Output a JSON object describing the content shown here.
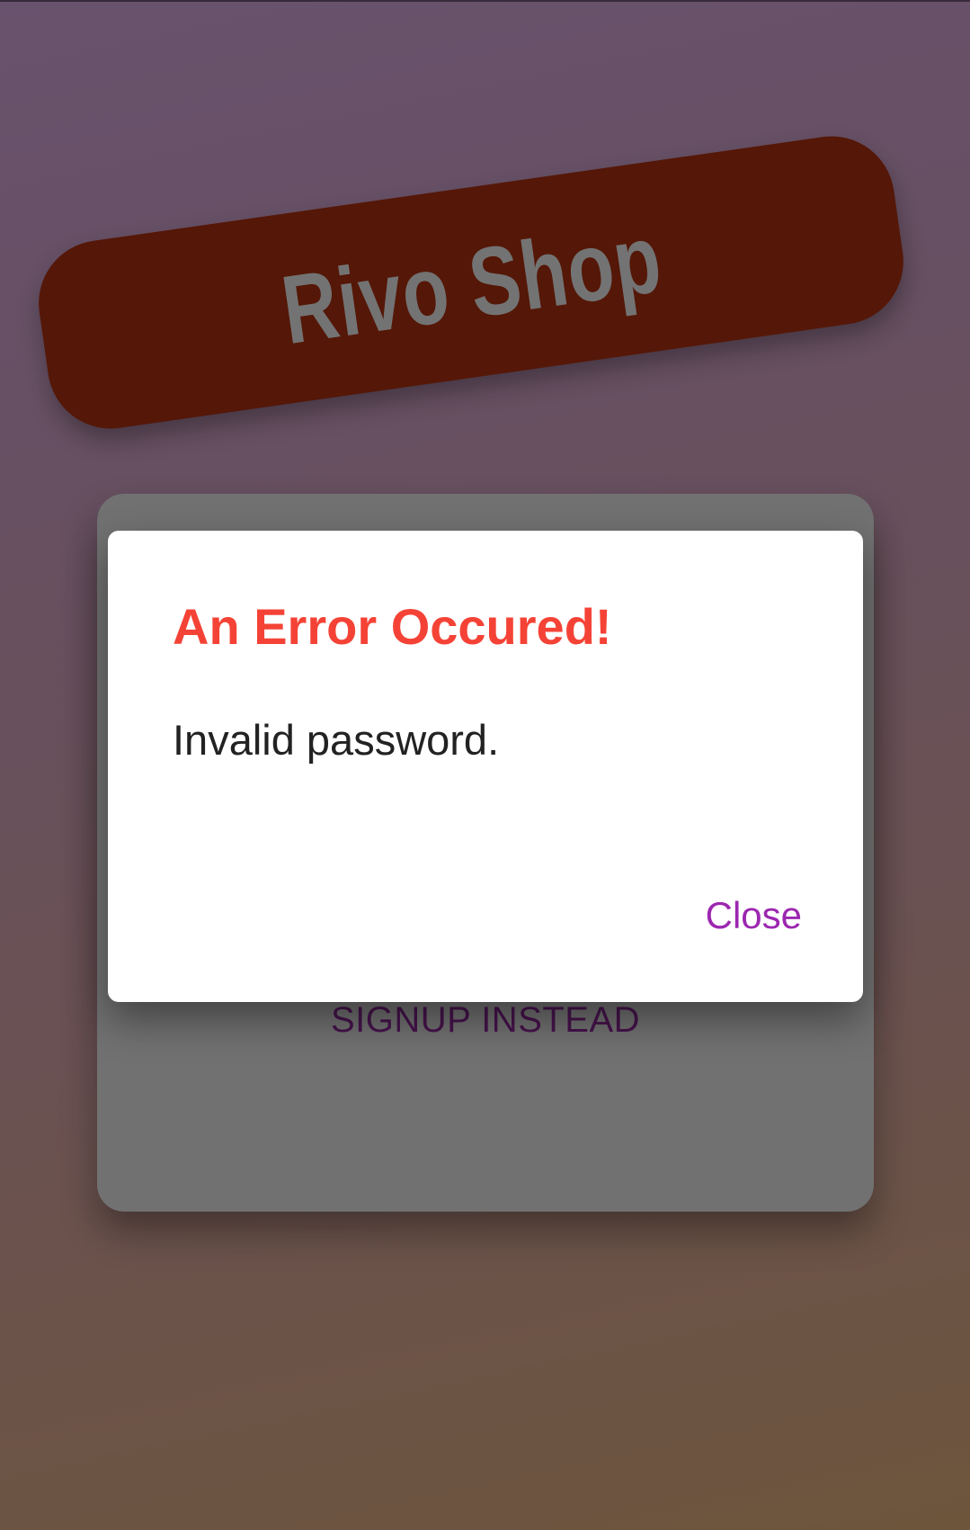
{
  "app": {
    "logo_text": "Rivo Shop"
  },
  "auth_card": {
    "signup_label": "SIGNUP INSTEAD"
  },
  "dialog": {
    "title": "An Error Occured!",
    "message": "Invalid password.",
    "close_label": "Close"
  },
  "colors": {
    "logo_banner": "#5a1908",
    "logo_text": "#7a7a7a",
    "card": "#787878",
    "primary_button": "#3d0f42",
    "signup_text": "#4b1552",
    "error_title": "#f44336",
    "close_action": "#9c27b0"
  }
}
